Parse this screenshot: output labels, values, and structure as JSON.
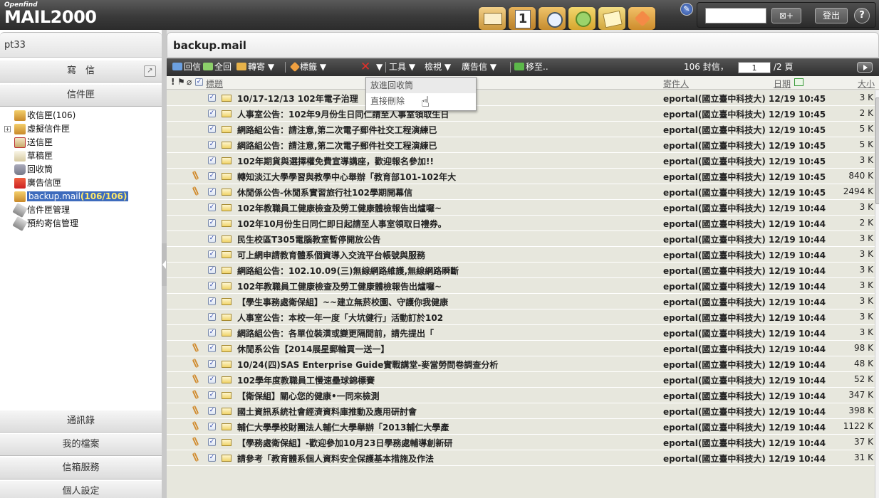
{
  "brand": {
    "small": "Openfind",
    "name": "MAIL2000"
  },
  "topbar": {
    "search_placeholder": "",
    "search_btn": "⊠+",
    "logout": "登出",
    "help": "?"
  },
  "app_icons": [
    "mail-icon",
    "calendar-icon",
    "clock-icon",
    "contacts-icon",
    "notes-icon",
    "tag-icon"
  ],
  "sidebar": {
    "user": "pt33",
    "compose": "寫　信",
    "mailbox": "信件匣",
    "folders": [
      {
        "label": "收信匣",
        "count": "(106)",
        "icon": "inbox-icon"
      },
      {
        "label": "虛擬信件匣",
        "count": "",
        "icon": "virtual-folder-icon"
      },
      {
        "label": "送信匣",
        "count": "",
        "icon": "sent-icon"
      },
      {
        "label": "草稿匣",
        "count": "",
        "icon": "draft-icon"
      },
      {
        "label": "回收筒",
        "count": "",
        "icon": "trash-icon"
      },
      {
        "label": "廣告信匣",
        "count": "",
        "icon": "ad-icon"
      },
      {
        "label": "backup.mail",
        "count": "(106/106)",
        "icon": "backup-folder-icon"
      },
      {
        "label": "信件匣管理",
        "count": "",
        "icon": "tools-icon"
      },
      {
        "label": "預約寄信管理",
        "count": "",
        "icon": "tools-icon"
      }
    ],
    "bottom": [
      "通訊錄",
      "我的檔案",
      "信箱服務",
      "個人設定"
    ]
  },
  "main": {
    "folder_title": "backup.mail",
    "toolbar": {
      "reply": "回信",
      "reply_all": "全回",
      "forward": "轉寄 ▼",
      "tag": "標籤 ▼",
      "delete_arrow": "▼",
      "tools": "工具 ▼",
      "view": "檢視 ▼",
      "ad": "廣告信 ▼",
      "move": "移至..",
      "count": "106 封信，",
      "page": "1",
      "pages": "/2 頁"
    },
    "headers": {
      "subject": "標題",
      "sender": "寄件人",
      "date": "日期",
      "size": "大小"
    },
    "delete_menu": [
      "放進回收筒",
      "直接刪除"
    ],
    "rows": [
      {
        "subject": "10/17-12/13 102年電子治理",
        "sender": "eportal(國立臺中科技大) 12/19 10:45",
        "size": "3 K",
        "attach": false
      },
      {
        "subject": "人事室公告：102年9月份生日同仁請至人事室領取生日",
        "sender": "eportal(國立臺中科技大) 12/19 10:45",
        "size": "2 K",
        "attach": false
      },
      {
        "subject": "網路組公告：請注意,第二次電子郵件社交工程演練已",
        "sender": "eportal(國立臺中科技大) 12/19 10:45",
        "size": "5 K",
        "attach": false
      },
      {
        "subject": "網路組公告：請注意,第二次電子郵件社交工程演練已",
        "sender": "eportal(國立臺中科技大) 12/19 10:45",
        "size": "5 K",
        "attach": false
      },
      {
        "subject": "102年期貨與選擇權免費宣導講座，歡迎報名參加!!",
        "sender": "eportal(國立臺中科技大) 12/19 10:45",
        "size": "3 K",
        "attach": false
      },
      {
        "subject": "轉知淡江大學學習與教學中心舉辦「教育部101-102年大",
        "sender": "eportal(國立臺中科技大) 12/19 10:45",
        "size": "840 K",
        "attach": true
      },
      {
        "subject": "休閒係公告-休閒系實習旅行社102學期開幕信",
        "sender": "eportal(國立臺中科技大) 12/19 10:45",
        "size": "2494 K",
        "attach": true
      },
      {
        "subject": "102年教職員工健康檢查及勞工健康體檢報告出爐囉~",
        "sender": "eportal(國立臺中科技大) 12/19 10:44",
        "size": "3 K",
        "attach": false
      },
      {
        "subject": "102年10月份生日同仁即日起請至人事室領取日禮券。",
        "sender": "eportal(國立臺中科技大) 12/19 10:44",
        "size": "2 K",
        "attach": false
      },
      {
        "subject": "民生校區T305電腦教室暫停開放公告",
        "sender": "eportal(國立臺中科技大) 12/19 10:44",
        "size": "3 K",
        "attach": false
      },
      {
        "subject": "可上網申請教育體系個資導入交流平台帳號與服務",
        "sender": "eportal(國立臺中科技大) 12/19 10:44",
        "size": "3 K",
        "attach": false
      },
      {
        "subject": "網路組公告：102.10.09(三)無線網路維護,無線網路瞬斷",
        "sender": "eportal(國立臺中科技大) 12/19 10:44",
        "size": "3 K",
        "attach": false
      },
      {
        "subject": "102年教職員工健康檢查及勞工健康體檢報告出爐囉~",
        "sender": "eportal(國立臺中科技大) 12/19 10:44",
        "size": "3 K",
        "attach": false
      },
      {
        "subject": "【學生事務處衛保組】~~建立無菸校園、守護你我健康",
        "sender": "eportal(國立臺中科技大) 12/19 10:44",
        "size": "3 K",
        "attach": false
      },
      {
        "subject": "人事室公告：本校一年一度「大坑健行」活動訂於102",
        "sender": "eportal(國立臺中科技大) 12/19 10:44",
        "size": "3 K",
        "attach": false
      },
      {
        "subject": "網路組公告：各單位裝潢或變更隔間前，請先提出「",
        "sender": "eportal(國立臺中科技大) 12/19 10:44",
        "size": "3 K",
        "attach": false
      },
      {
        "subject": "休閒系公告【2014展星郵輪買一送一】",
        "sender": "eportal(國立臺中科技大) 12/19 10:44",
        "size": "98 K",
        "attach": true
      },
      {
        "subject": "10/24(四)SAS Enterprise Guide實戰講堂-麥當勞問卷調查分析",
        "sender": "eportal(國立臺中科技大) 12/19 10:44",
        "size": "48 K",
        "attach": true
      },
      {
        "subject": "102學年度教職員工慢速壘球錦標賽",
        "sender": "eportal(國立臺中科技大) 12/19 10:44",
        "size": "52 K",
        "attach": true
      },
      {
        "subject": "【衛保組】關心您的健康•一同來檢測",
        "sender": "eportal(國立臺中科技大) 12/19 10:44",
        "size": "347 K",
        "attach": true
      },
      {
        "subject": "國土資訊系統社會經濟資料庫推動及應用研討會",
        "sender": "eportal(國立臺中科技大) 12/19 10:44",
        "size": "398 K",
        "attach": true
      },
      {
        "subject": "輔仁大學學校財團法人輔仁大學舉辦「2013輔仁大學產",
        "sender": "eportal(國立臺中科技大) 12/19 10:44",
        "size": "1122 K",
        "attach": true
      },
      {
        "subject": "【學務處衛保組】-歡迎參加10月23日學務處輔導創新研",
        "sender": "eportal(國立臺中科技大) 12/19 10:44",
        "size": "37 K",
        "attach": true
      },
      {
        "subject": "請參考「教育體系個人資料安全保護基本措施及作法",
        "sender": "eportal(國立臺中科技大) 12/19 10:44",
        "size": "31 K",
        "attach": true
      }
    ]
  }
}
